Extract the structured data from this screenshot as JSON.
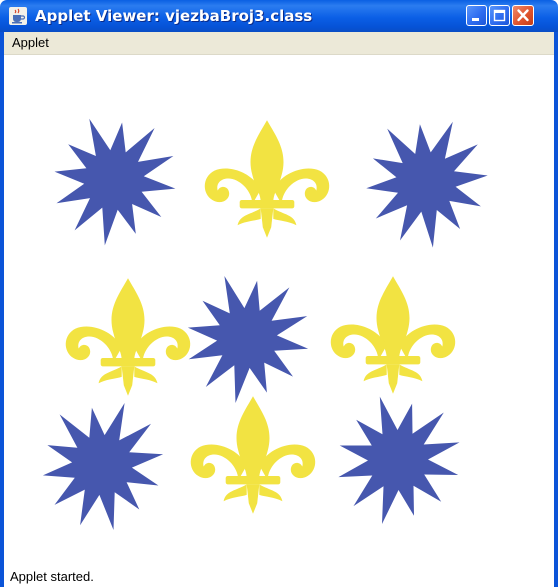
{
  "window": {
    "title": "Applet Viewer: vjezbaBroj3.class",
    "app_icon": "java-cup-icon",
    "controls": [
      "minimize-icon",
      "maximize-icon",
      "close-icon"
    ]
  },
  "menubar": {
    "items": [
      {
        "label": "Applet"
      }
    ]
  },
  "canvas": {
    "rows": [
      [
        "star",
        "fleur-de-lis",
        "star"
      ],
      [
        "fleur-de-lis",
        "star",
        "fleur-de-lis"
      ],
      [
        "star",
        "fleur-de-lis",
        "star"
      ]
    ],
    "colors": {
      "star": "#4657ae",
      "fleur-de-lis": "#f2e342",
      "background": "#ffffff"
    }
  },
  "status": {
    "text": "Applet started."
  },
  "theme": {
    "titlebar": "#0a5fe3",
    "menubar_bg": "#ece9d8",
    "close_button": "#e0542e"
  }
}
